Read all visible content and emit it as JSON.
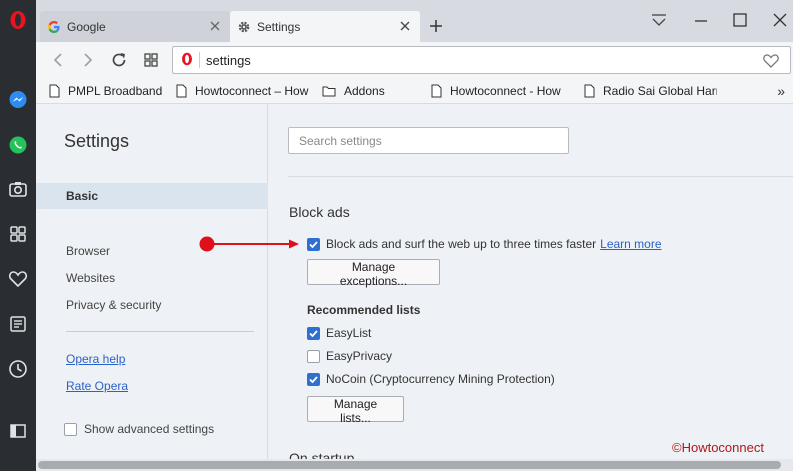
{
  "tabs": [
    {
      "title": "Google",
      "active": false
    },
    {
      "title": "Settings",
      "active": true
    }
  ],
  "address": {
    "url": "settings"
  },
  "bookmarks": [
    {
      "label": "PMPL Broadband",
      "type": "page"
    },
    {
      "label": "Howtoconnect – How",
      "type": "page"
    },
    {
      "label": "Addons",
      "type": "folder"
    },
    {
      "label": "Howtoconnect - How",
      "type": "page"
    },
    {
      "label": "Radio Sai Global Harr",
      "type": "page"
    }
  ],
  "bookmarks_more": "»",
  "sidebar_icons": [
    "opera-logo-icon",
    "messenger-icon",
    "whatsapp-icon",
    "camera-icon",
    "speed-dial-icon",
    "heart-icon",
    "news-icon",
    "history-icon",
    "sidebar-toggle-icon"
  ],
  "settings_nav": {
    "title": "Settings",
    "basic": "Basic",
    "items": [
      "Browser",
      "Websites",
      "Privacy & security"
    ],
    "links": [
      "Opera help",
      "Rate Opera"
    ],
    "advanced": "Show advanced settings",
    "advanced_checked": false
  },
  "main": {
    "search_placeholder": "Search settings",
    "block_ads": {
      "heading": "Block ads",
      "checkbox_label": "Block ads and surf the web up to three times faster",
      "checkbox_checked": true,
      "learn_more": "Learn more",
      "manage_exceptions": "Manage exceptions...",
      "recommended_heading": "Recommended lists",
      "lists": [
        {
          "label": "EasyList",
          "checked": true
        },
        {
          "label": "EasyPrivacy",
          "checked": false
        },
        {
          "label": "NoCoin (Cryptocurrency Mining Protection)",
          "checked": true
        }
      ],
      "manage_lists": "Manage lists..."
    },
    "next_section": "On startup"
  },
  "watermark": "©Howtoconnect",
  "colors": {
    "accent": "#2f6fcf",
    "annotation": "#e0101a",
    "opera_red": "#e8141f"
  }
}
